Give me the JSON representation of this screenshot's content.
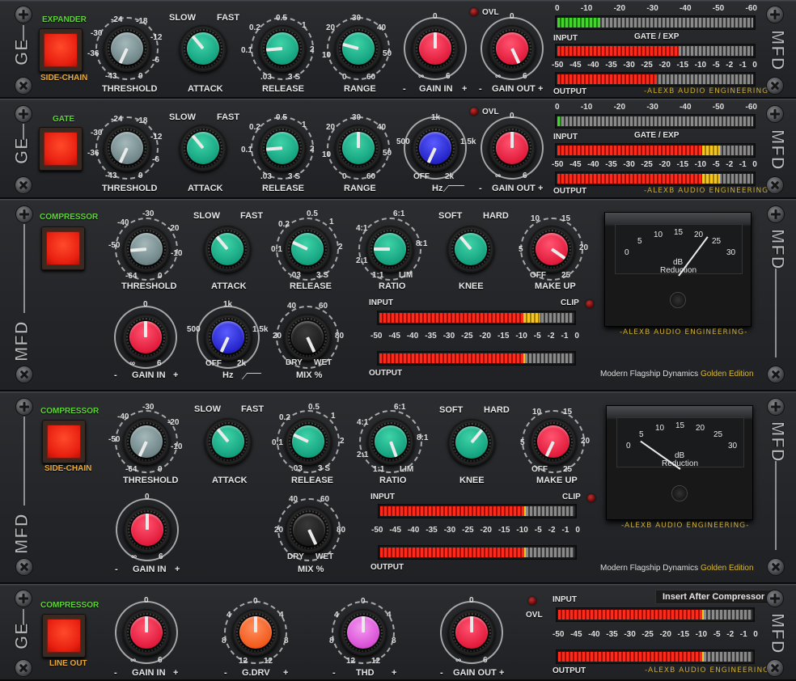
{
  "colors": {
    "green_label": "#5fd43a",
    "orange_label": "#e8a93c",
    "gold": "#d9b73a",
    "knob_teal": "#14a27f",
    "knob_red": "#e21b3c",
    "knob_grey": "#7d9597",
    "knob_blue": "#2424c8",
    "knob_black": "#1c1c1c",
    "knob_orange": "#f25a1c",
    "knob_magenta": "#d94fd6",
    "meter_red": "#ff2a1a",
    "meter_yellow": "#f5c520",
    "meter_green": "#41d62a"
  },
  "brand": {
    "ge": "GE",
    "mfd": "MFD",
    "maker": "-ALEXB AUDIO ENGINEERING-",
    "edition_prefix": "Modern Flagship Dynamics",
    "edition_suffix": "Golden Edition"
  },
  "units": [
    {
      "type": "gate",
      "top_label": "EXPANDER",
      "bottom_label": "SIDE-CHAIN",
      "threshold": {
        "label": "THRESHOLD",
        "ticks": [
          "-24",
          "-18",
          "-30",
          "-12",
          "-36",
          "-6",
          "-43",
          "0"
        ],
        "pointer_deg": -155
      },
      "attack": {
        "label": "ATTACK",
        "left": "SLOW",
        "right": "FAST",
        "pointer_deg": -40
      },
      "release": {
        "label": "RELEASE",
        "ticks": [
          "0.5",
          "0.2",
          "1",
          "0.1",
          "2",
          ".03",
          "3 S"
        ],
        "pointer_deg": -95
      },
      "range": {
        "label": "RANGE",
        "ticks": [
          "30",
          "20",
          "40",
          "10",
          "50",
          "0",
          "60"
        ],
        "pointer_deg": -75
      },
      "gain_in": {
        "label": "GAIN IN",
        "minus": "-",
        "plus": "+",
        "top": "0",
        "left": "∞",
        "right": "6",
        "pointer_deg": 0
      },
      "gain_out": {
        "label": "GAIN OUT",
        "minus": "-",
        "plus": "+",
        "top": "0",
        "left": "∞",
        "right": "6",
        "pointer_deg": 155
      },
      "ovl": "OVL",
      "meter": {
        "top_scale": [
          "0",
          "-10",
          "-20",
          "-30",
          "-40",
          "-50",
          "-60"
        ],
        "input_label": "INPUT",
        "mode_label": "GATE / EXP",
        "output_label": "OUTPUT",
        "bottom_scale": [
          "-50",
          "-45",
          "-40",
          "-35",
          "-30",
          "-25",
          "-20",
          "-15",
          "-10",
          "-5",
          "-2",
          "-1",
          "0"
        ],
        "gate_fill": 0.22,
        "input_fill": 0.62,
        "input_yellow": 0,
        "output_fill": 0.51,
        "output_yellow": 0
      }
    },
    {
      "type": "gate",
      "top_label": "GATE",
      "bottom_label": "",
      "threshold": {
        "label": "THRESHOLD",
        "ticks": [
          "-24",
          "-18",
          "-30",
          "-12",
          "-36",
          "-6",
          "-43",
          "0"
        ],
        "pointer_deg": -155
      },
      "attack": {
        "label": "ATTACK",
        "left": "SLOW",
        "right": "FAST",
        "pointer_deg": -40
      },
      "release": {
        "label": "RELEASE",
        "ticks": [
          "0.5",
          "0.2",
          "1",
          "0.1",
          "2",
          ".03",
          "3 S"
        ],
        "pointer_deg": -95
      },
      "range": {
        "label": "RANGE",
        "ticks": [
          "30",
          "20",
          "40",
          "10",
          "50",
          "0",
          "60"
        ],
        "pointer_deg": 0
      },
      "hz": {
        "label": "Hz",
        "ticks": [
          "1k",
          "500",
          "1.5k",
          "OFF",
          "2k"
        ],
        "pointer_deg": -155
      },
      "gain_out": {
        "label": "GAIN OUT",
        "minus": "-",
        "plus": "+",
        "top": "0",
        "left": "∞",
        "right": "6",
        "pointer_deg": 0
      },
      "ovl": "OVL",
      "meter": {
        "top_scale": [
          "0",
          "-10",
          "-20",
          "-30",
          "-40",
          "-50",
          "-60"
        ],
        "input_label": "INPUT",
        "mode_label": "GATE / EXP",
        "output_label": "OUTPUT",
        "bottom_scale": [
          "-50",
          "-45",
          "-40",
          "-35",
          "-30",
          "-25",
          "-20",
          "-15",
          "-10",
          "-5",
          "-2",
          "-1",
          "0"
        ],
        "gate_fill": 0.02,
        "input_fill": 0.74,
        "input_yellow": 0.09,
        "output_fill": 0.74,
        "output_yellow": 0.09
      }
    }
  ],
  "comps": [
    {
      "top_label": "COMPRESSOR",
      "bottom_label": "",
      "threshold": {
        "label": "THRESHOLD",
        "ticks": [
          "-30",
          "-40",
          "-20",
          "-50",
          "-10",
          "-64",
          "0"
        ],
        "pointer_deg": -95
      },
      "attack": {
        "label": "ATTACK",
        "left": "SLOW",
        "right": "FAST",
        "pointer_deg": -40
      },
      "release": {
        "label": "RELEASE",
        "ticks": [
          "0.5",
          "0.2",
          "1",
          "0.1",
          "2",
          ".03",
          "3 S"
        ],
        "pointer_deg": -65
      },
      "ratio": {
        "label": "RATIO",
        "ticks": [
          "6:1",
          "4:1",
          "8:1",
          "2:1",
          "1:1",
          "LIM"
        ],
        "pointer_deg": -90
      },
      "knee": {
        "label": "KNEE",
        "left": "SOFT",
        "right": "HARD",
        "pointer_deg": -40
      },
      "makeup": {
        "label": "MAKE UP",
        "ticks": [
          "10",
          "15",
          "5",
          "20",
          "OFF",
          "25"
        ],
        "pointer_deg": 125
      },
      "gain_in": {
        "label": "GAIN IN",
        "minus": "-",
        "plus": "+",
        "top": "0",
        "left": "∞",
        "right": "6",
        "pointer_deg": 0
      },
      "hz": {
        "label": "Hz",
        "ticks": [
          "1k",
          "500",
          "1.5k",
          "OFF",
          "2k"
        ],
        "pointer_deg": -155
      },
      "mix": {
        "label": "MIX %",
        "ticks": [
          "40",
          "60",
          "20",
          "80",
          "DRY",
          "WET"
        ],
        "pointer_deg": 155
      },
      "meter": {
        "input_label": "INPUT",
        "clip_label": "CLIP",
        "output_label": "OUTPUT",
        "scale": [
          "-50",
          "-45",
          "-40",
          "-35",
          "-30",
          "-25",
          "-20",
          "-15",
          "-10",
          "-5",
          "-2",
          "-1",
          "0"
        ],
        "input_fill": 0.74,
        "input_yellow": 0.09,
        "output_fill": 0.74,
        "output_yellow": 0.01
      },
      "vu": {
        "ticks": [
          "0",
          "5",
          "10",
          "15",
          "20",
          "25",
          "30"
        ],
        "label1": "dB",
        "label2": "Reduction",
        "value_db": 25
      }
    },
    {
      "top_label": "COMPRESSOR",
      "bottom_label": "SIDE-CHAIN",
      "threshold": {
        "label": "THRESHOLD",
        "ticks": [
          "-30",
          "-40",
          "-20",
          "-50",
          "-10",
          "-64",
          "0"
        ],
        "pointer_deg": -155
      },
      "attack": {
        "label": "ATTACK",
        "left": "SLOW",
        "right": "FAST",
        "pointer_deg": -40
      },
      "release": {
        "label": "RELEASE",
        "ticks": [
          "0.5",
          "0.2",
          "1",
          "0.1",
          "2",
          ".03",
          "3 S"
        ],
        "pointer_deg": -65
      },
      "ratio": {
        "label": "RATIO",
        "ticks": [
          "6:1",
          "4:1",
          "8:1",
          "2:1",
          "1:1",
          "LIM"
        ],
        "pointer_deg": 160
      },
      "knee": {
        "label": "KNEE",
        "left": "SOFT",
        "right": "HARD",
        "pointer_deg": 40
      },
      "makeup": {
        "label": "MAKE UP",
        "ticks": [
          "10",
          "15",
          "5",
          "20",
          "OFF",
          "25"
        ],
        "pointer_deg": -155
      },
      "gain_in": {
        "label": "GAIN IN",
        "minus": "-",
        "plus": "+",
        "top": "0",
        "left": "∞",
        "right": "6",
        "pointer_deg": 0
      },
      "mix": {
        "label": "MIX %",
        "ticks": [
          "40",
          "60",
          "20",
          "80",
          "DRY",
          "WET"
        ],
        "pointer_deg": 155
      },
      "meter": {
        "input_label": "INPUT",
        "clip_label": "CLIP",
        "output_label": "OUTPUT",
        "scale": [
          "-50",
          "-45",
          "-40",
          "-35",
          "-30",
          "-25",
          "-20",
          "-15",
          "-10",
          "-5",
          "-2",
          "-1",
          "0"
        ],
        "input_fill": 0.74,
        "input_yellow": 0.01,
        "output_fill": 0.74,
        "output_yellow": 0.01
      },
      "vu": {
        "ticks": [
          "0",
          "5",
          "10",
          "15",
          "20",
          "25",
          "30"
        ],
        "label1": "dB",
        "label2": "Reduction",
        "value_db": 0
      }
    }
  ],
  "sat": {
    "top_label": "COMPRESSOR",
    "bottom_label": "LINE OUT",
    "gain_in": {
      "label": "GAIN IN",
      "minus": "-",
      "plus": "+",
      "top": "0",
      "left": "∞",
      "right": "6",
      "pointer_deg": 0
    },
    "gdrv": {
      "label": "G.DRV",
      "minus": "-",
      "plus": "+",
      "ticks": [
        "0",
        "4",
        "4",
        "8",
        "8",
        "12",
        "12"
      ],
      "pointer_deg": 0
    },
    "thd": {
      "label": "THD",
      "minus": "-",
      "plus": "+",
      "ticks": [
        "0",
        "4",
        "4",
        "8",
        "8",
        "12",
        "12"
      ],
      "pointer_deg": 0
    },
    "gain_out": {
      "label": "GAIN OUT",
      "minus": "-",
      "plus": "+",
      "top": "0",
      "left": "∞",
      "right": "6",
      "pointer_deg": 0
    },
    "ovl": "OVL",
    "tooltip": "Insert After Compressor",
    "meter": {
      "input_label": "INPUT",
      "output_label": "OUTPUT",
      "scale": [
        "-50",
        "-45",
        "-40",
        "-35",
        "-30",
        "-25",
        "-20",
        "-15",
        "-10",
        "-5",
        "-2",
        "-1",
        "0"
      ],
      "input_fill": 0.74,
      "input_yellow": 0.01,
      "output_fill": 0.74,
      "output_yellow": 0.01
    }
  }
}
